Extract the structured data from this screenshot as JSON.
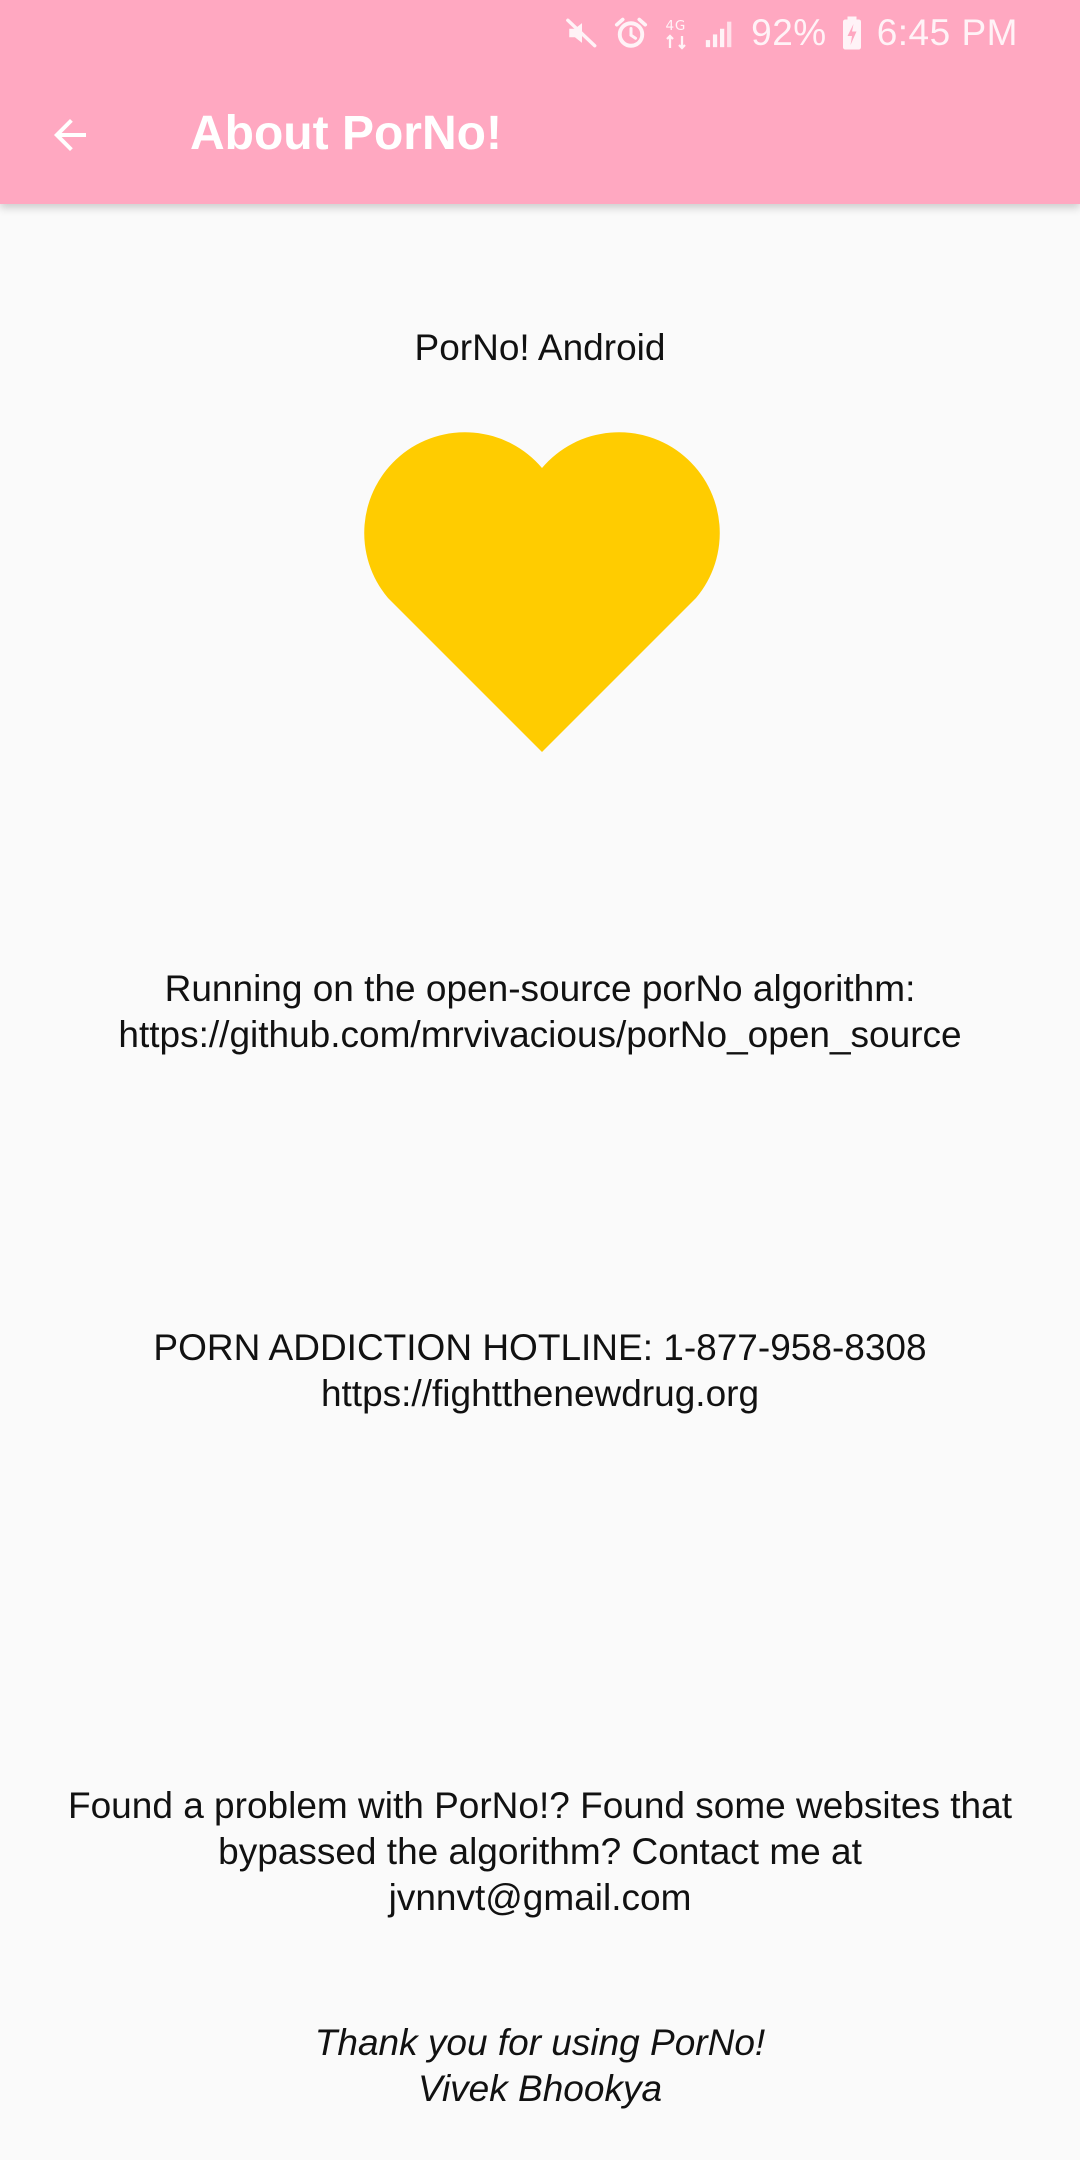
{
  "status_bar": {
    "battery": "92%",
    "time": "6:45 PM",
    "icons": [
      "mute-icon",
      "alarm-icon",
      "data-icon",
      "signal-icon",
      "battery-charging-icon"
    ]
  },
  "toolbar": {
    "back_icon": "arrow-back-icon",
    "title": "About PorNo!"
  },
  "colors": {
    "appbar": "#FFA8C1",
    "heart": "#FFCC00",
    "background": "#FAFAFA"
  },
  "content": {
    "app_name": "PorNo! Android",
    "logo_icon": "heart-icon",
    "algorithm_line1": "Running on the open-source porNo algorithm:",
    "algorithm_link": "https://github.com/mrvivacious/porNo_open_source",
    "hotline_line": "PORN ADDICTION HOTLINE: 1-877-958-8308",
    "hotline_link": "https://fightthenewdrug.org",
    "problem_line1": "Found a problem with PorNo!? Found some websites that",
    "problem_line2": "bypassed the algorithm? Contact me at",
    "problem_email": "jvnnvt@gmail.com",
    "thanks_line1": "Thank you for using PorNo!",
    "thanks_line2": "Vivek Bhookya"
  }
}
